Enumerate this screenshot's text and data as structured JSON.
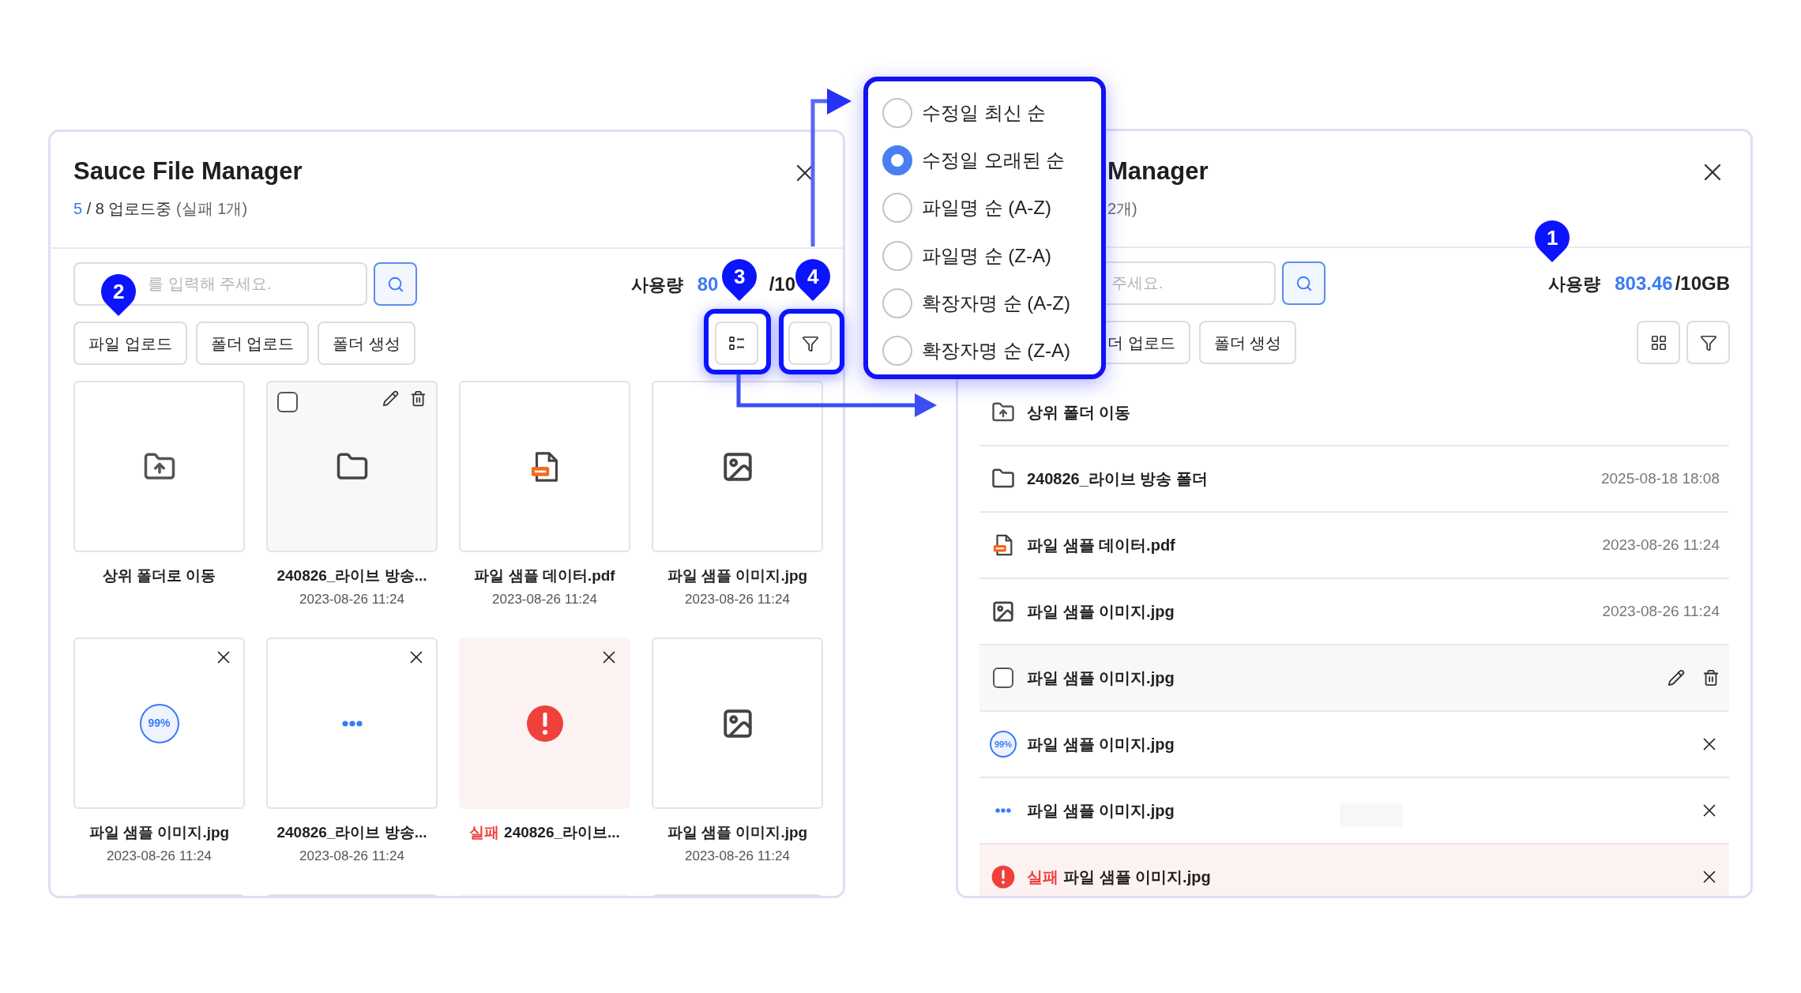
{
  "left_window": {
    "title": "Sauce File Manager",
    "upload_status": {
      "done": "5",
      "total": "/ 8 업로드중",
      "failed": "(실패 1개)"
    },
    "search": {
      "placeholder": "를 입력해 주세요."
    },
    "usage": {
      "label": "사용량",
      "used": "80",
      "capacity": "/10"
    },
    "actions": [
      "파일 업로드",
      "폴더 업로드",
      "폴더 생성"
    ],
    "tool_buttons": [
      {
        "kind": "list"
      },
      {
        "kind": "filter"
      }
    ],
    "cards": [
      {
        "kind": "parent",
        "name": "상위 폴더로 이동",
        "hovered": false
      },
      {
        "kind": "folder",
        "name": "240826_라이브 방송...",
        "date": "2023-08-26 11:24",
        "hovered": true,
        "checked": false
      },
      {
        "kind": "pdf",
        "name": "파일 샘플 데이터.pdf",
        "date": "2023-08-26 11:24",
        "hovered": false
      },
      {
        "kind": "image",
        "name": "파일 샘플 이미지.jpg",
        "date": "2023-08-26 11:24",
        "hovered": false
      },
      {
        "kind": "progress",
        "progress": "99%",
        "name": "파일 샘플 이미지.jpg",
        "date": "2023-08-26 11:24",
        "hovered": false
      },
      {
        "kind": "pending",
        "name": "240826_라이브 방송...",
        "date": "2023-08-26 11:24",
        "hovered": false
      },
      {
        "kind": "failed",
        "status": "실패",
        "name": "240826_라이브...",
        "hovered": false
      },
      {
        "kind": "image",
        "name": "파일 샘플 이미지.jpg",
        "date": "2023-08-26 11:24",
        "hovered": false
      }
    ],
    "cut_off_cards": [
      {
        "kind": "blank"
      },
      {
        "kind": "blank"
      },
      {
        "kind": "failed"
      },
      {
        "kind": "blank"
      }
    ]
  },
  "sort_menu": {
    "options": [
      {
        "label": "수정일 최신 순",
        "selected": false
      },
      {
        "label": "수정일 오래된 순",
        "selected": true
      },
      {
        "label": "파일명 순 (A-Z)",
        "selected": false
      },
      {
        "label": "파일명 순 (Z-A)",
        "selected": false
      },
      {
        "label": "확장자명 순 (A-Z)",
        "selected": false
      },
      {
        "label": "확장자명 순 (Z-A)",
        "selected": false
      }
    ]
  },
  "right_window": {
    "title": "Manager",
    "upload_status": "2개)",
    "search": {
      "placeholder": "주세요."
    },
    "usage": {
      "label": "사용량",
      "used": "803.46",
      "capacity": "/10GB"
    },
    "actions": [
      "더 업로드",
      "폴더 생성"
    ],
    "tool_buttons": [
      {
        "kind": "grid"
      },
      {
        "kind": "filter"
      }
    ],
    "rows": [
      {
        "kind": "parent",
        "name": "상위 폴더 이동",
        "hovered": false
      },
      {
        "kind": "folder",
        "name": "240826_라이브 방송 폴더",
        "date": "2025-08-18 18:08",
        "hovered": false
      },
      {
        "kind": "pdf",
        "name": "파일 샘플 데이터.pdf",
        "date": "2023-08-26 11:24",
        "hovered": false
      },
      {
        "kind": "image",
        "name": "파일 샘플 이미지.jpg",
        "date": "2023-08-26 11:24",
        "hovered": false
      },
      {
        "kind": "image",
        "name": "파일 샘플 이미지.jpg",
        "hovered": true,
        "checked": false
      },
      {
        "kind": "progress",
        "progress": "99%",
        "name": "파일 샘플 이미지.jpg",
        "hovered": false
      },
      {
        "kind": "pending",
        "name": "파일 샘플 이미지.jpg",
        "hovered": false
      },
      {
        "kind": "failed",
        "status": "실패",
        "name": "파일 샘플 이미지.jpg",
        "hovered": false
      }
    ]
  },
  "callouts": [
    {
      "label": "1"
    },
    {
      "label": "2"
    },
    {
      "label": "3"
    },
    {
      "label": "4"
    }
  ]
}
